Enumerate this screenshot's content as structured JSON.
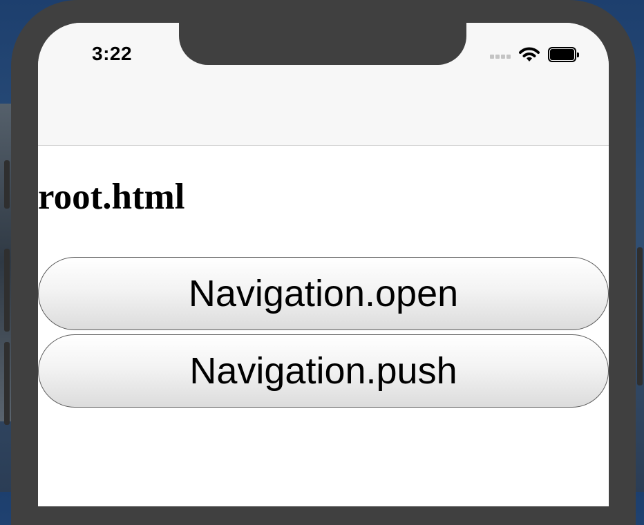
{
  "status_bar": {
    "time": "3:22",
    "icons": [
      "signal-icon",
      "wifi-icon",
      "battery-icon"
    ]
  },
  "page": {
    "title": "root.html"
  },
  "buttons": {
    "open_label": "Navigation.open",
    "push_label": "Navigation.push"
  },
  "colors": {
    "device_frame": "#404040",
    "screen_background": "#ffffff",
    "nav_bar_background": "#f7f7f7",
    "button_border": "#5c5c5c"
  }
}
